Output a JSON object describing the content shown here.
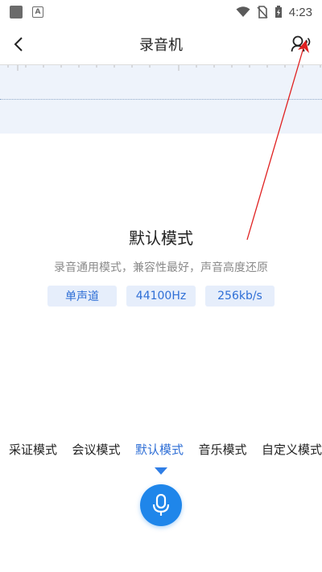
{
  "status_bar": {
    "time": "4:23"
  },
  "header": {
    "title": "录音机"
  },
  "mode": {
    "name": "默认模式",
    "description": "录音通用模式，兼容性最好，声音高度还原",
    "tags": [
      "单声道",
      "44100Hz",
      "256kb/s"
    ]
  },
  "mode_tabs": [
    {
      "label": "采证模式"
    },
    {
      "label": "会议模式"
    },
    {
      "label": "默认模式",
      "active": true
    },
    {
      "label": "音乐模式"
    },
    {
      "label": "自定义模式"
    }
  ],
  "colors": {
    "accent": "#2f6fd6",
    "record_button": "#1f86ea",
    "wave_bg": "#eef3fb",
    "annotation": "#e02020"
  }
}
